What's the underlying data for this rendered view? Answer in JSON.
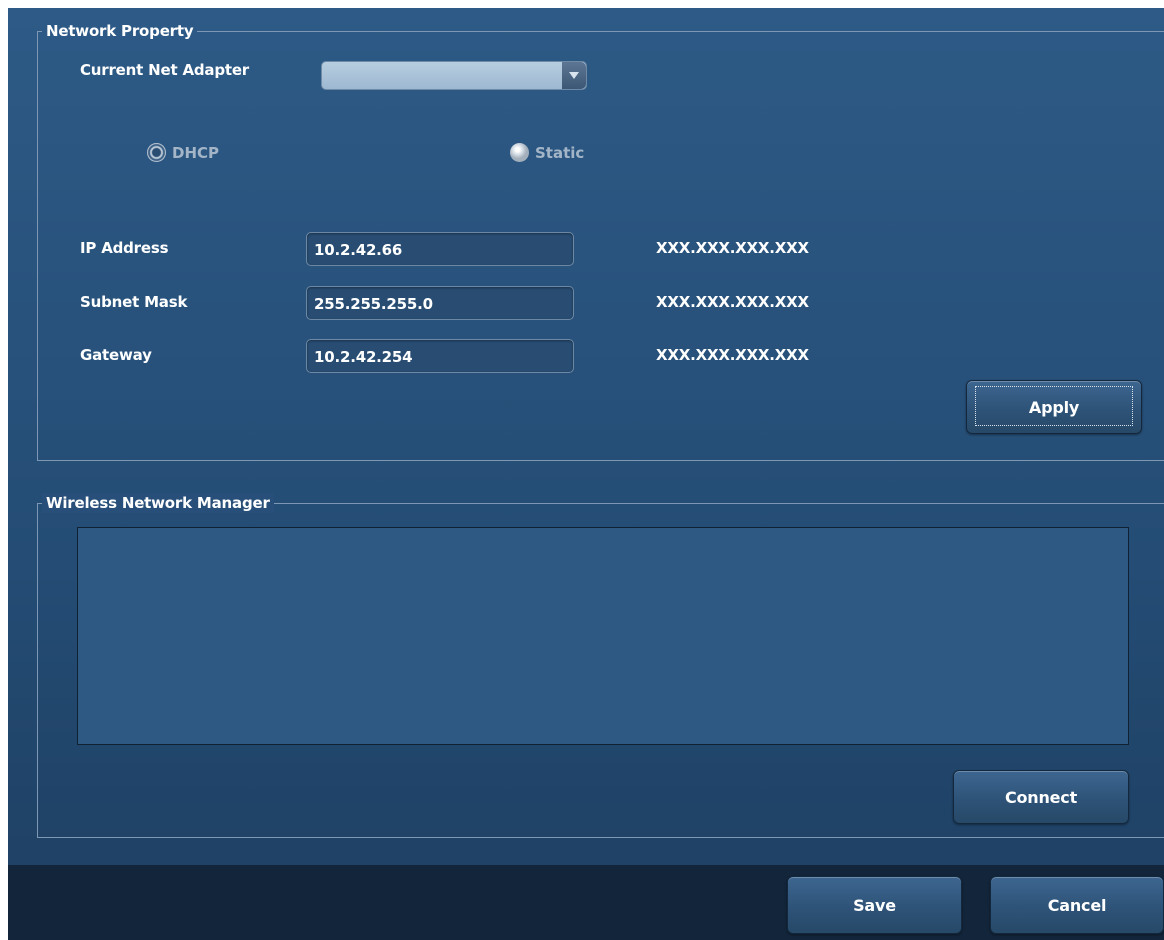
{
  "network_property": {
    "title": "Network Property",
    "adapter_label": "Current Net Adapter",
    "adapter_value": "",
    "mode_options": [
      {
        "label": "DHCP",
        "selected": true
      },
      {
        "label": "Static",
        "selected": false
      }
    ],
    "fields": [
      {
        "label": "IP Address",
        "value": "10.2.42.66",
        "format": "XXX.XXX.XXX.XXX"
      },
      {
        "label": "Subnet Mask",
        "value": "255.255.255.0",
        "format": "XXX.XXX.XXX.XXX"
      },
      {
        "label": "Gateway",
        "value": "10.2.42.254",
        "format": "XXX.XXX.XXX.XXX"
      }
    ],
    "apply_label": "Apply"
  },
  "wireless": {
    "title": "Wireless Network Manager",
    "networks": [],
    "connect_label": "Connect"
  },
  "footer": {
    "save_label": "Save",
    "cancel_label": "Cancel"
  },
  "colors": {
    "panel_background": "#2d5a86",
    "footer_background": "#13253a",
    "disabled_text": "#a4b5c7"
  }
}
